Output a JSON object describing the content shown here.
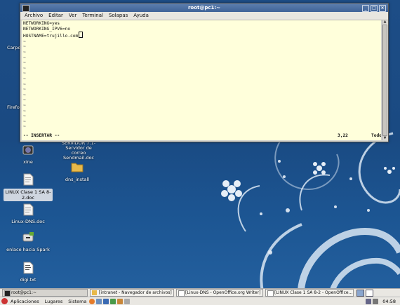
{
  "window": {
    "title": "root@pc1:~",
    "menu": [
      "Archivo",
      "Editar",
      "Ver",
      "Terminal",
      "Solapas",
      "Ayuda"
    ],
    "lines": [
      "NETWORKING=yes",
      "NETWORKING_IPV6=no",
      "HOSTNAME=trujillo.com"
    ],
    "tilde": "~",
    "status_mode": "-- INSERTAR --",
    "status_pos": "3,22",
    "status_all": "Todo"
  },
  "desktop": {
    "partial_labels": [
      "Carpet",
      "Firefox"
    ],
    "behind_text": [
      "SERVIDOR 7.1-",
      "Servidor de correo",
      "Sendmail.doc"
    ],
    "icons": [
      {
        "name": "xine-icon",
        "label": "xine"
      },
      {
        "name": "folder-icon",
        "label": "dns_install"
      },
      {
        "name": "document-icon",
        "label": "LINUX Clase 1 SA 8-2.doc"
      },
      {
        "name": "document-icon",
        "label": "Linux-DNS.doc"
      },
      {
        "name": "link-icon",
        "label": "enlace hacia Spark"
      },
      {
        "name": "text-file-icon",
        "label": "digi.txt"
      }
    ]
  },
  "panel": {
    "tasks": [
      "root@pc1:~",
      "[intranet - Navegador de archivos]",
      "[Linux-DNS - OpenOffice.org Writer]",
      "[LINUX Clase 1 SA 8-2 - OpenOffice..."
    ],
    "menus": [
      "Aplicaciones",
      "Lugares",
      "Sistema"
    ],
    "clock": "04:58"
  },
  "colors": {
    "terminal_bg": "#ffffdb",
    "titlebar": "#4a6da0",
    "desktop": "#1d4d86"
  }
}
